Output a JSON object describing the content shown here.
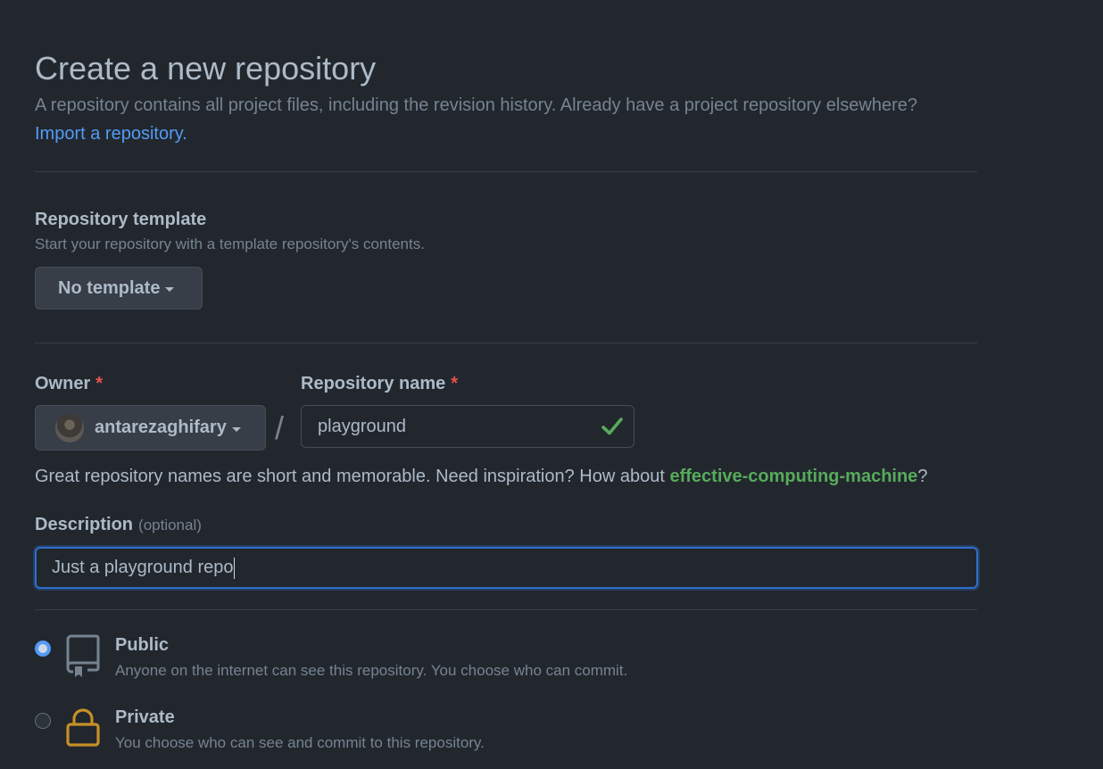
{
  "header": {
    "title": "Create a new repository",
    "subtitle": "A repository contains all project files, including the revision history. Already have a project repository elsewhere?",
    "import_link": "Import a repository."
  },
  "template": {
    "title": "Repository template",
    "note": "Start your repository with a template repository's contents.",
    "selected": "No template"
  },
  "owner": {
    "label": "Owner",
    "required_mark": "*",
    "value": "antarezaghifary"
  },
  "separator": "/",
  "repo_name": {
    "label": "Repository name",
    "required_mark": "*",
    "value": "playground",
    "valid_icon": "check-icon"
  },
  "name_hint": {
    "text": "Great repository names are short and memorable. Need inspiration? How about ",
    "suggestion": "effective-computing-machine",
    "suffix": "?"
  },
  "description": {
    "label": "Description",
    "optional": "(optional)",
    "value": "Just a playground repo"
  },
  "visibility": {
    "options": [
      {
        "label": "Public",
        "note": "Anyone on the internet can see this repository. You choose who can commit.",
        "icon": "repo-icon",
        "selected": true
      },
      {
        "label": "Private",
        "note": "You choose who can see and commit to this repository.",
        "icon": "lock-icon",
        "selected": false
      }
    ]
  },
  "colors": {
    "background": "#22272e",
    "link": "#539bf5",
    "success": "#57ab5a",
    "danger": "#e5534b",
    "lock": "#c69026",
    "focus": "#316dca"
  }
}
